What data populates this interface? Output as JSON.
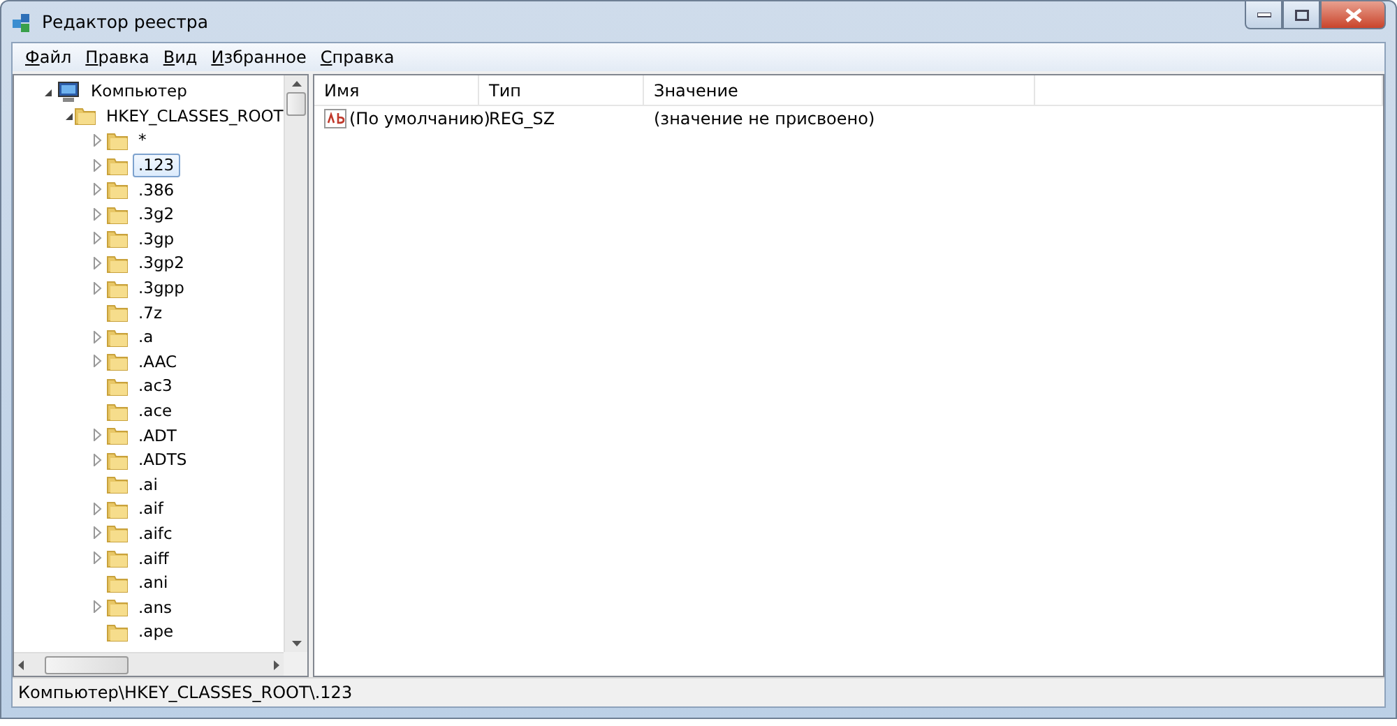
{
  "window": {
    "title": "Редактор реестра"
  },
  "menu": [
    "Файл",
    "Правка",
    "Вид",
    "Избранное",
    "Справка"
  ],
  "tree": [
    {
      "label": "Компьютер",
      "kind": "computer",
      "expanded": true,
      "selected": false,
      "children": [
        {
          "label": "HKEY_CLASSES_ROOT",
          "kind": "folder",
          "expanded": true,
          "selected": false,
          "children": [
            {
              "label": "*",
              "kind": "folder",
              "expandable": true,
              "selected": false
            },
            {
              "label": ".123",
              "kind": "folder",
              "expandable": true,
              "selected": true
            },
            {
              "label": ".386",
              "kind": "folder",
              "expandable": true,
              "selected": false
            },
            {
              "label": ".3g2",
              "kind": "folder",
              "expandable": true,
              "selected": false
            },
            {
              "label": ".3gp",
              "kind": "folder",
              "expandable": true,
              "selected": false
            },
            {
              "label": ".3gp2",
              "kind": "folder",
              "expandable": true,
              "selected": false
            },
            {
              "label": ".3gpp",
              "kind": "folder",
              "expandable": true,
              "selected": false
            },
            {
              "label": ".7z",
              "kind": "folder",
              "expandable": false,
              "selected": false
            },
            {
              "label": ".a",
              "kind": "folder",
              "expandable": true,
              "selected": false
            },
            {
              "label": ".AAC",
              "kind": "folder",
              "expandable": true,
              "selected": false
            },
            {
              "label": ".ac3",
              "kind": "folder",
              "expandable": false,
              "selected": false
            },
            {
              "label": ".ace",
              "kind": "folder",
              "expandable": false,
              "selected": false
            },
            {
              "label": ".ADT",
              "kind": "folder",
              "expandable": true,
              "selected": false
            },
            {
              "label": ".ADTS",
              "kind": "folder",
              "expandable": true,
              "selected": false
            },
            {
              "label": ".ai",
              "kind": "folder",
              "expandable": false,
              "selected": false
            },
            {
              "label": ".aif",
              "kind": "folder",
              "expandable": true,
              "selected": false
            },
            {
              "label": ".aifc",
              "kind": "folder",
              "expandable": true,
              "selected": false
            },
            {
              "label": ".aiff",
              "kind": "folder",
              "expandable": true,
              "selected": false
            },
            {
              "label": ".ani",
              "kind": "folder",
              "expandable": false,
              "selected": false
            },
            {
              "label": ".ans",
              "kind": "folder",
              "expandable": true,
              "selected": false
            },
            {
              "label": ".ape",
              "kind": "folder",
              "expandable": false,
              "selected": false
            }
          ]
        }
      ]
    }
  ],
  "values": {
    "columns": [
      "Имя",
      "Тип",
      "Значение"
    ],
    "rows": [
      {
        "name": "(По умолчанию)",
        "type": "REG_SZ",
        "value": "(значение не присвоено)"
      }
    ]
  },
  "status_bar": "Компьютер\\HKEY_CLASSES_ROOT\\.123"
}
